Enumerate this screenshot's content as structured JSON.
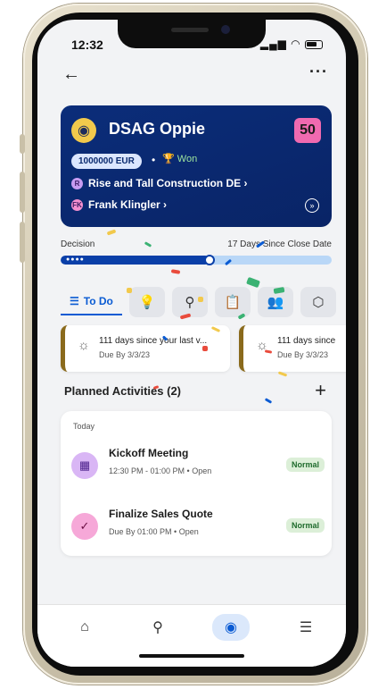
{
  "status_bar": {
    "time": "12:32",
    "icons": "signal-wifi-battery"
  },
  "header": {
    "back_icon": "arrow-left-icon",
    "more_icon": "more-horizontal-icon"
  },
  "opportunity": {
    "title": "DSAG Oppie",
    "score": "50",
    "amount": "1000000 EUR",
    "status": "Won",
    "company": "Rise and Tall Construction DE ›",
    "contact": "Frank Klingler ›",
    "company_initial": "R",
    "contact_initial": "FK"
  },
  "decision": {
    "label": "Decision",
    "since_label": "17 Days Since Close Date",
    "progress_percent": 55
  },
  "tabs": {
    "todo_label": "To Do",
    "icons": [
      "lightbulb-icon",
      "map-pin-icon",
      "clipboard-icon",
      "people-icon",
      "cube-icon"
    ]
  },
  "todo_cards": [
    {
      "text": "111 days since your last v...",
      "due": "Due By 3/3/23"
    },
    {
      "text": "111 days since",
      "due": "Due By 3/3/23"
    }
  ],
  "planned": {
    "title": "Planned Activities (2)",
    "section": "Today",
    "items": [
      {
        "title": "Kickoff Meeting",
        "sub": "12:30 PM - 01:00 PM  •  Open",
        "badge": "Normal",
        "icon": "calendar-icon"
      },
      {
        "title": "Finalize Sales Quote",
        "sub": "Due By 01:00 PM  •  Open",
        "badge": "Normal",
        "icon": "task-icon"
      }
    ]
  },
  "bottom_nav": [
    "home-icon",
    "search-icon",
    "opportunity-icon",
    "menu-icon"
  ],
  "colors": {
    "card_bg": "#0b2d7a",
    "accent": "#0a5bd3",
    "score_bg": "#f06ab0",
    "badge_bg": "#dcefd8"
  }
}
